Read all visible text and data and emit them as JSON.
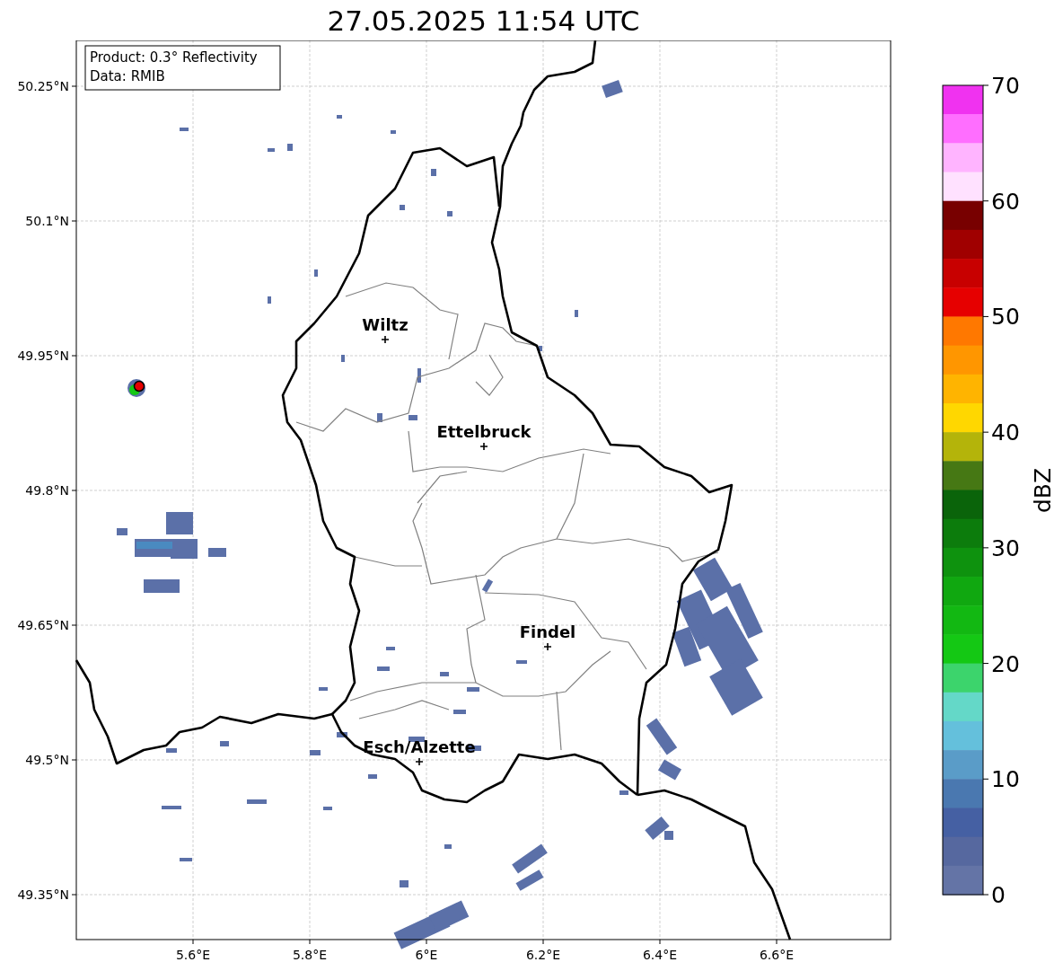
{
  "title": "27.05.2025 11:54 UTC",
  "map": {
    "info_box": [
      "Product: 0.3° Reflectivity",
      "Data: RMIB"
    ],
    "grid": true,
    "lon_labels": [
      "5.6°E",
      "5.8°E",
      "6°E",
      "6.2°E",
      "6.4°E",
      "6.6°E"
    ],
    "lat_labels": [
      "50.25°N",
      "50.1°N",
      "49.95°N",
      "49.8°N",
      "49.65°N",
      "49.5°N",
      "49.35°N"
    ],
    "cities": [
      {
        "name": "Wiltz"
      },
      {
        "name": "Ettelbruck"
      },
      {
        "name": "Findel"
      },
      {
        "name": "Esch/Alzette"
      }
    ]
  },
  "colorbar": {
    "label": "dBZ",
    "ticks": [
      "70",
      "60",
      "50",
      "40",
      "30",
      "20",
      "10",
      "0"
    ],
    "bins": [
      {
        "color": "#f032f0"
      },
      {
        "color": "#ff6eff"
      },
      {
        "color": "#ffb4ff"
      },
      {
        "color": "#ffe1ff"
      },
      {
        "color": "#780000"
      },
      {
        "color": "#a00000"
      },
      {
        "color": "#c80000"
      },
      {
        "color": "#e60000"
      },
      {
        "color": "#ff7800"
      },
      {
        "color": "#ff9600"
      },
      {
        "color": "#ffb400"
      },
      {
        "color": "#ffd700"
      },
      {
        "color": "#b4b40a"
      },
      {
        "color": "#467814"
      },
      {
        "color": "#0a640a"
      },
      {
        "color": "#0c7c0c"
      },
      {
        "color": "#0e920e"
      },
      {
        "color": "#10a810"
      },
      {
        "color": "#12b812"
      },
      {
        "color": "#14c814"
      },
      {
        "color": "#3cd46c"
      },
      {
        "color": "#64d8c8"
      },
      {
        "color": "#64c0dc"
      },
      {
        "color": "#5a9cc8"
      },
      {
        "color": "#4a78b0"
      },
      {
        "color": "#4560a3"
      },
      {
        "color": "#56689f"
      },
      {
        "color": "#6474a6"
      }
    ]
  }
}
